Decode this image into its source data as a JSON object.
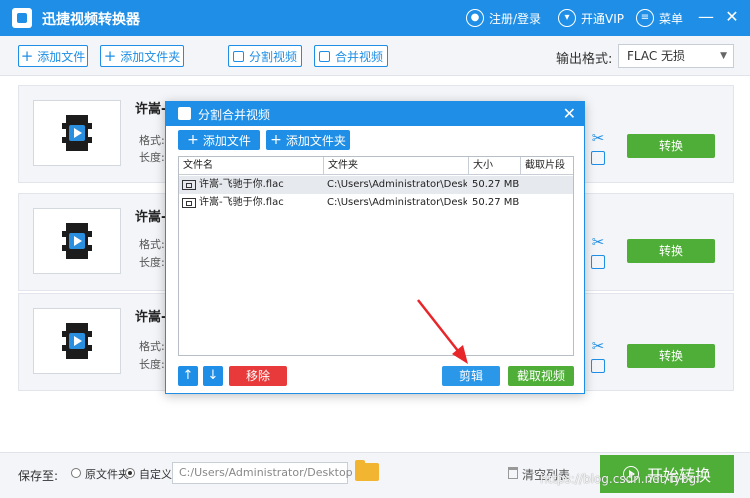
{
  "window": {
    "app_title": "迅捷视频转换器",
    "register_login": "注册/登录",
    "open_vip": "开通VIP",
    "menu": "菜单",
    "minimize": "—",
    "close": "✕"
  },
  "toolbar": {
    "add_file": "添加文件",
    "add_folder": "添加文件夹",
    "split_video": "分割视频",
    "merge_video": "合并视频",
    "output_format_label": "输出格式:",
    "output_format_value": "FLAC 无损"
  },
  "items": [
    {
      "name": "许嵩-",
      "format_label": "格式:",
      "length_label": "长度:",
      "convert": "转换"
    },
    {
      "name": "许嵩-",
      "format_label": "格式:",
      "length_label": "长度:",
      "convert": "转换"
    },
    {
      "name": "许嵩-",
      "format_label": "格式:",
      "length_label": "长度:",
      "convert": "转换"
    }
  ],
  "dialog": {
    "title": "分割合并视频",
    "add_file": "添加文件",
    "add_folder": "添加文件夹",
    "columns": [
      "文件名",
      "文件夹",
      "大小",
      "截取片段"
    ],
    "rows": [
      {
        "name": "许嵩-飞驰于你.flac",
        "folder": "C:\\Users\\Administrator\\Desktop",
        "size": "50.27 MB",
        "segment": ""
      },
      {
        "name": "许嵩-飞驰于你.flac",
        "folder": "C:\\Users\\Administrator\\Desktop",
        "size": "50.27 MB",
        "segment": ""
      }
    ],
    "up": "↑",
    "down": "↓",
    "remove": "移除",
    "clip": "剪辑",
    "extract_video": "截取视频"
  },
  "bottom": {
    "save_to": "保存至:",
    "original_folder": "原文件夹",
    "custom": "自定义",
    "path": "C:/Users/Administrator/Desktop",
    "clear_list": "清空列表",
    "start_convert": "开始转换",
    "watermark": "https://blog.csdn.net/Tybgi"
  },
  "colors": {
    "accent": "#1e8ee6",
    "convert_green": "#4eae37",
    "remove_red": "#e83a3a",
    "annotation_arrow": "#e8262a"
  }
}
